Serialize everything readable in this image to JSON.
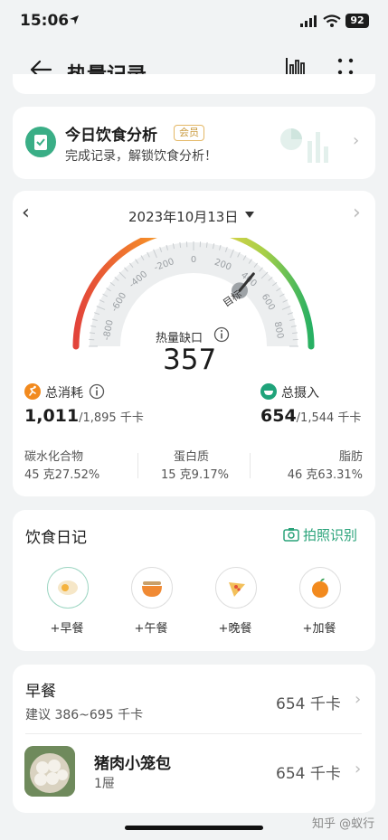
{
  "status": {
    "time": "15:06",
    "battery": "92"
  },
  "header": {
    "title": "热量记录"
  },
  "analysis": {
    "title": "今日饮食分析",
    "badge": "会员",
    "subtitle": "完成记录，解锁饮食分析！"
  },
  "date": {
    "label": "2023年10月13日"
  },
  "gauge": {
    "ticks": [
      "-800",
      "-600",
      "-400",
      "-200",
      "0",
      "200",
      "400",
      "600",
      "800"
    ],
    "target_label": "目标",
    "deficit_label": "热量缺口",
    "deficit_value": "357",
    "deficit_level": 0.72
  },
  "consumption": {
    "label": "总消耗",
    "value": "1,011",
    "total": "/1,895 千卡"
  },
  "intake": {
    "label": "总摄入",
    "value": "654",
    "total": "/1,544 千卡"
  },
  "macros": [
    {
      "name": "碳水化合物",
      "value": "45 克27.52%"
    },
    {
      "name": "蛋白质",
      "value": "15 克9.17%"
    },
    {
      "name": "脂肪",
      "value": "46 克63.31%"
    }
  ],
  "diary": {
    "title": "饮食日记",
    "photo": "拍照识别",
    "meals": [
      {
        "label": "+早餐",
        "icon": "egg-icon"
      },
      {
        "label": "+午餐",
        "icon": "bowl-icon"
      },
      {
        "label": "+晚餐",
        "icon": "pizza-icon"
      },
      {
        "label": "+加餐",
        "icon": "orange-icon"
      }
    ]
  },
  "breakfast": {
    "title": "早餐",
    "suggest": "建议 386~695 千卡",
    "kcal": "654 千卡",
    "item": {
      "name": "猪肉小笼包",
      "qty": "1屉",
      "kcal": "654 千卡"
    }
  },
  "watermark": "知乎 @蚁行",
  "colors": {
    "accent": "#2bb673",
    "orange": "#f28a1e",
    "red": "#e0453a"
  }
}
